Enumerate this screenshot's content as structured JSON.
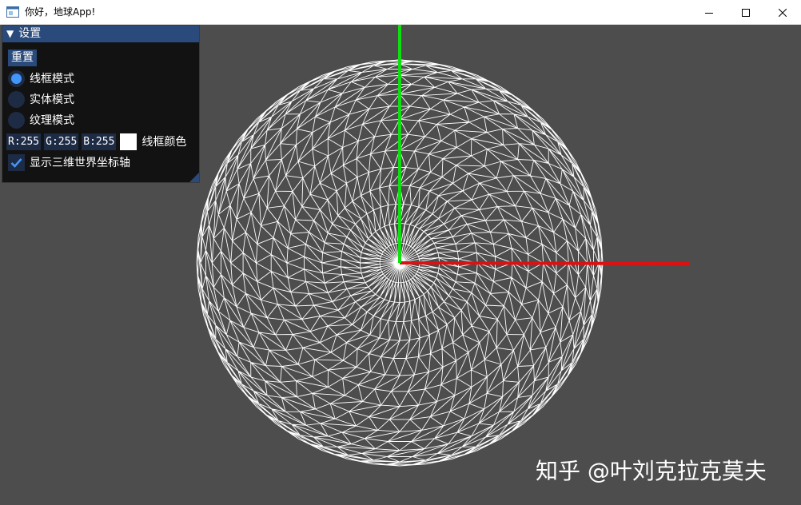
{
  "window": {
    "title": "你好，地球App!",
    "icon": "app-window-icon",
    "controls": [
      "minimize-icon",
      "maximize-icon",
      "close-icon"
    ]
  },
  "settings_panel": {
    "title": "设置",
    "collapse_icon": "triangle-down-icon",
    "reset_label": "重置",
    "render_modes": [
      {
        "label": "线框模式",
        "selected": true
      },
      {
        "label": "实体模式",
        "selected": false
      },
      {
        "label": "纹理模式",
        "selected": false
      }
    ],
    "wire_color": {
      "r": "R:255",
      "g": "G:255",
      "b": "B:255",
      "swatch": "#ffffff",
      "label": "线框颜色"
    },
    "show_axes": {
      "label": "显示三维世界坐标轴",
      "checked": true
    }
  },
  "scene": {
    "background": "#4d4d4d",
    "wireframe_color": "#ffffff",
    "x_axis_color": "#dd1111",
    "y_axis_color": "#11dd11"
  },
  "watermark": "知乎 @叶刘克拉克莫夫"
}
